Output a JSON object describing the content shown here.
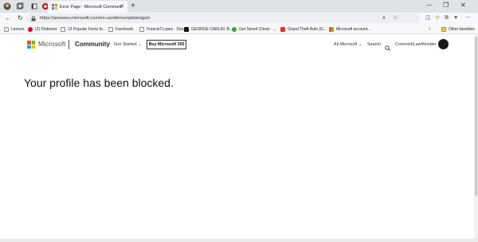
{
  "browser": {
    "tab": {
      "title": "Error Page - Microsoft Communit..."
    },
    "address": {
      "url": "https://answers.microsoft.com/en-us/site/completesignin"
    },
    "bookmarks": [
      {
        "label": "Lenovo",
        "icon_color": "#e8e8e8"
      },
      {
        "label": "(2) Pinterest",
        "icon_color": "#e60023"
      },
      {
        "label": "13 Popular Fonts In...",
        "icon_color": "#ffffff"
      },
      {
        "label": "Facebook",
        "icon_color": "#ffffff"
      },
      {
        "label": "FrancisTLopez · Dev...",
        "icon_color": "#ffffff"
      },
      {
        "label": "GEORGE CARLIN: B...",
        "icon_color": "#111111"
      },
      {
        "label": "Get Sims4 Cheat - ...",
        "icon_color": "#3aa13a"
      },
      {
        "label": "Grand Theft Auto (G...",
        "icon_color": "#e52d27"
      },
      {
        "label": "Microsoft account...",
        "icon_color": "#f25022"
      }
    ],
    "other_favorites": "Other favorites"
  },
  "header": {
    "brand": "Microsoft",
    "community": "Community",
    "get_started": "Get Started ⌄",
    "buy_button": "Buy Microsoft 365",
    "all_microsoft": "All Microsoft ⌄",
    "search": "Search",
    "username": "CommishLawWonder"
  },
  "main": {
    "message": "Your profile has been blocked."
  },
  "colors": {
    "ms_red": "#f25022",
    "ms_green": "#7fba00",
    "ms_blue": "#00a4ef",
    "ms_yellow": "#ffb900"
  }
}
